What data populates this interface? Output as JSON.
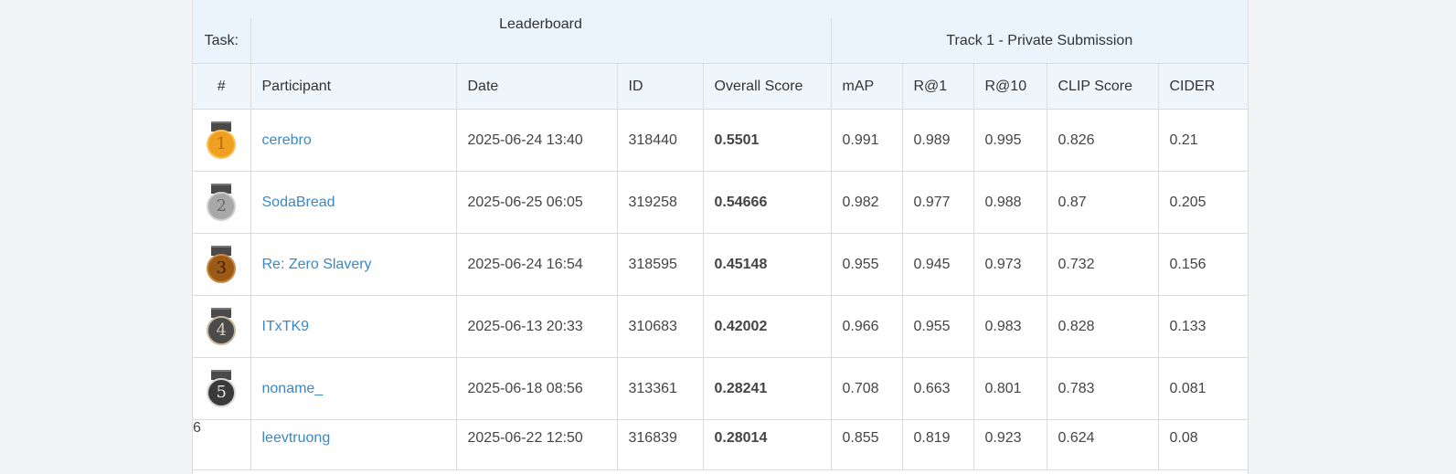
{
  "header": {
    "task_label": "Task:",
    "leaderboard_title": "Leaderboard",
    "track_title": "Track 1 - Private Submission"
  },
  "columns": [
    "#",
    "Participant",
    "Date",
    "ID",
    "Overall Score",
    "mAP",
    "R@1",
    "R@10",
    "CLIP Score",
    "CIDER"
  ],
  "medal_colors": {
    "gold": "#f0a020",
    "silver": "#a8a8a8",
    "bronze": "#9c5a16",
    "dark": "#4b4b4b"
  },
  "rows": [
    {
      "rank": "1",
      "participant": "cerebro",
      "date": "2025-06-24 13:40",
      "id": "318440",
      "overall": "0.5501",
      "map": "0.991",
      "r1": "0.989",
      "r10": "0.995",
      "clip": "0.826",
      "cider": "0.21"
    },
    {
      "rank": "2",
      "participant": "SodaBread",
      "date": "2025-06-25 06:05",
      "id": "319258",
      "overall": "0.54666",
      "map": "0.982",
      "r1": "0.977",
      "r10": "0.988",
      "clip": "0.87",
      "cider": "0.205"
    },
    {
      "rank": "3",
      "participant": "Re: Zero Slavery",
      "date": "2025-06-24 16:54",
      "id": "318595",
      "overall": "0.45148",
      "map": "0.955",
      "r1": "0.945",
      "r10": "0.973",
      "clip": "0.732",
      "cider": "0.156"
    },
    {
      "rank": "4",
      "participant": "ITxTK9",
      "date": "2025-06-13 20:33",
      "id": "310683",
      "overall": "0.42002",
      "map": "0.966",
      "r1": "0.955",
      "r10": "0.983",
      "clip": "0.828",
      "cider": "0.133"
    },
    {
      "rank": "5",
      "participant": "noname_",
      "date": "2025-06-18 08:56",
      "id": "313361",
      "overall": "0.28241",
      "map": "0.708",
      "r1": "0.663",
      "r10": "0.801",
      "clip": "0.783",
      "cider": "0.081"
    },
    {
      "rank": "6",
      "participant": "leevtruong",
      "date": "2025-06-22 12:50",
      "id": "316839",
      "overall": "0.28014",
      "map": "0.855",
      "r1": "0.819",
      "r10": "0.923",
      "clip": "0.624",
      "cider": "0.08"
    }
  ]
}
